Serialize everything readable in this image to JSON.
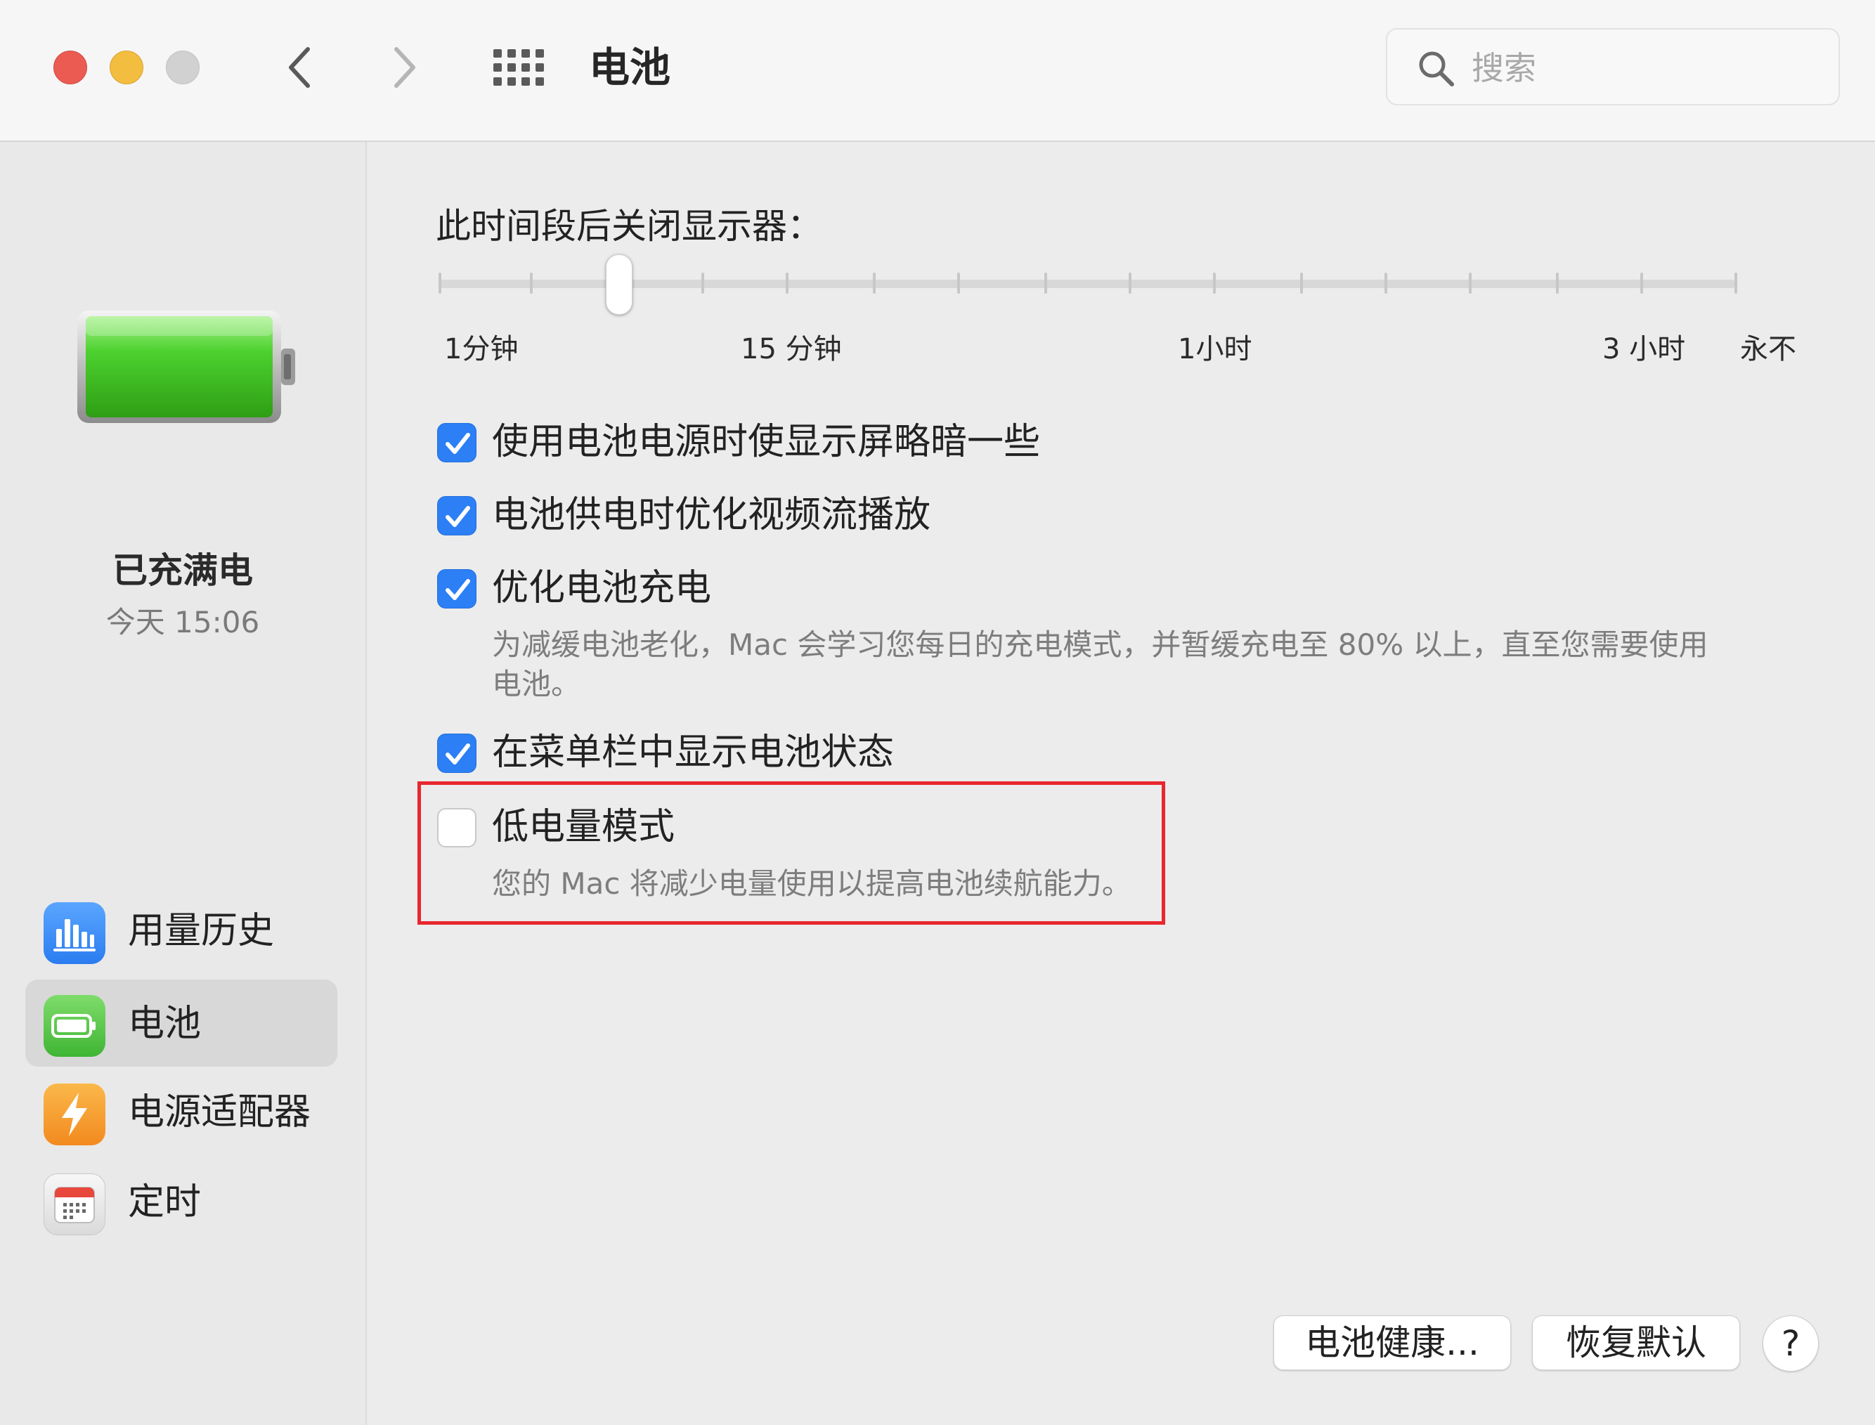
{
  "window": {
    "title": "电池",
    "search_placeholder": "搜索"
  },
  "sidebar": {
    "battery_status": "已充满电",
    "battery_time": "今天 15:06",
    "items": [
      {
        "label": "用量历史",
        "icon": "bar-chart-icon",
        "color": "#3d8ef7"
      },
      {
        "label": "电池",
        "icon": "battery-icon",
        "color": "#5ac24f",
        "selected": true
      },
      {
        "label": "电源适配器",
        "icon": "lightning-icon",
        "color": "#f7a033"
      },
      {
        "label": "定时",
        "icon": "calendar-icon",
        "color": "#e5e5e5"
      }
    ]
  },
  "display_sleep": {
    "title": "此时间段后关闭显示器：",
    "tick_labels": [
      "1分钟",
      "15 分钟",
      "1小时",
      "3 小时",
      "永不"
    ],
    "current_value": "3分钟"
  },
  "options": [
    {
      "label": "使用电池电源时使显示屏略暗一些",
      "checked": true
    },
    {
      "label": "电池供电时优化视频流播放",
      "checked": true
    },
    {
      "label": "优化电池充电",
      "checked": true,
      "description_line1": "为减缓电池老化，Mac 会学习您每日的充电模式，并暂缓充电至 80% 以上，直至您需要使用",
      "description_line2": "电池。"
    },
    {
      "label": "在菜单栏中显示电池状态",
      "checked": true
    },
    {
      "label": "低电量模式",
      "checked": false,
      "description_line1": "您的 Mac 将减少电量使用以提高电池续航能力。"
    }
  ],
  "buttons": {
    "battery_health": "电池健康...",
    "restore_defaults": "恢复默认",
    "help": "?"
  },
  "colors": {
    "accent": "#2c7ff5",
    "highlight": "#e8272e",
    "battery_green": "#4cd12f"
  }
}
